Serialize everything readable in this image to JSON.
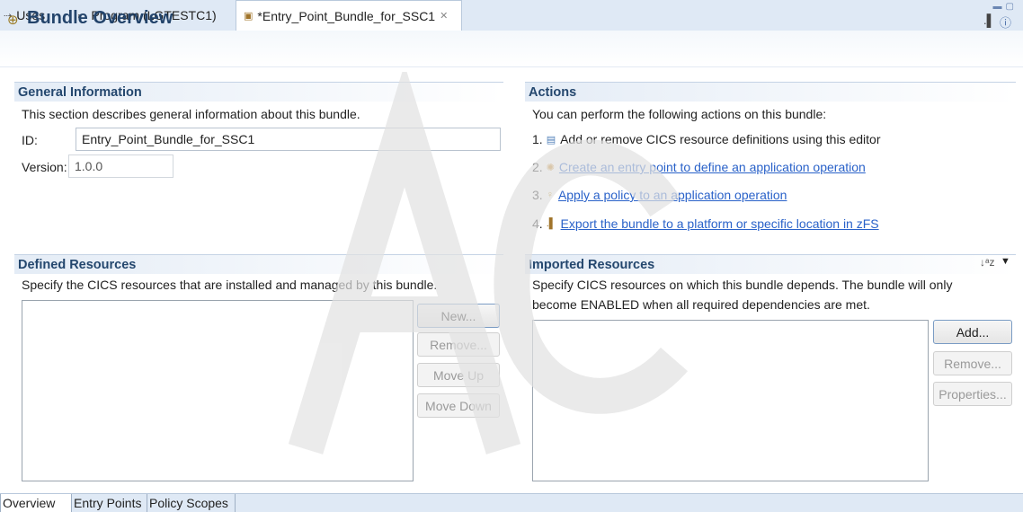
{
  "tabs": [
    {
      "label": "Uses",
      "icon": "uses-icon"
    },
    {
      "label": "Program (LGTESTC1)",
      "icon": "program-icon"
    },
    {
      "label": "*Entry_Point_Bundle_for_SSC1",
      "icon": "bundle-icon",
      "active": true
    }
  ],
  "header": {
    "title": "Bundle Overview"
  },
  "general": {
    "heading": "General Information",
    "description": "This section describes general information about this bundle.",
    "id_label": "ID:",
    "id_value": "Entry_Point_Bundle_for_SSC1",
    "version_label": "Version:",
    "version_value": "1.0.0"
  },
  "actions": {
    "heading": "Actions",
    "description": "You can perform the following actions on this bundle:",
    "items": [
      {
        "num": "1.",
        "text": "Add or remove CICS resource definitions using this editor",
        "link": false
      },
      {
        "num": "2.",
        "text": "Create an entry point to define an application operation",
        "link": true
      },
      {
        "num": "3.",
        "text": "Apply a policy to an application operation",
        "link": true
      },
      {
        "num": "4.",
        "text": "Export the bundle to a platform or specific location in zFS",
        "link": true
      }
    ]
  },
  "defined": {
    "heading": "Defined Resources",
    "description": "Specify the CICS resources that are installed and managed by this bundle.",
    "buttons": {
      "new": "New...",
      "remove": "Remove...",
      "move_up": "Move Up",
      "move_down": "Move Down"
    }
  },
  "imported": {
    "heading": "Imported Resources",
    "description_line1": "Specify CICS resources on which this bundle depends. The bundle will only",
    "description_line2": "become ENABLED when all required dependencies are met.",
    "buttons": {
      "add": "Add...",
      "remove": "Remove...",
      "properties": "Properties..."
    }
  },
  "bottom_tabs": [
    "Overview",
    "Entry Points",
    "Policy Scopes"
  ],
  "colors": {
    "heading": "#24476e",
    "link": "#2a62c9",
    "tabbar": "#dfe9f5"
  }
}
